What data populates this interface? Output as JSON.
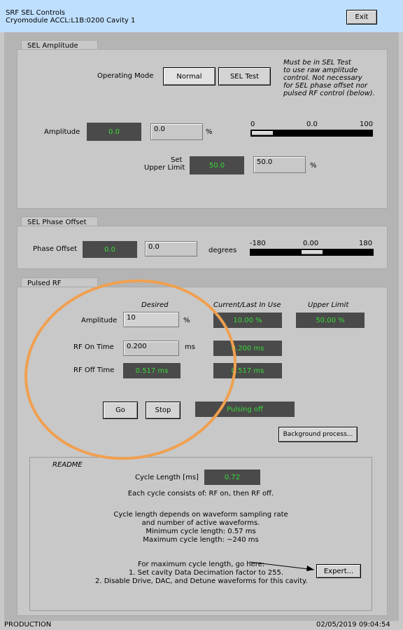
{
  "window": {
    "title_line1": "SRF SEL Controls",
    "title_line2": "Cryomodule ACCL:L1B:0200 Cavity 1",
    "exit_label": "Exit"
  },
  "sel_amplitude": {
    "tab": "SEL Amplitude",
    "operating_mode_label": "Operating Mode",
    "mode_normal": "Normal",
    "mode_sel_test": "SEL Test",
    "note_lines": [
      "Must be in SEL Test",
      "to use raw amplitude",
      "control. Not necessary",
      "for SEL phase offset nor",
      "pulsed RF control (below)."
    ],
    "amplitude_label": "Amplitude",
    "amplitude_readback": "0.0",
    "amplitude_input": "0.0",
    "amplitude_unit": "%",
    "slider_min": "0",
    "slider_value": "0.0",
    "slider_max": "100",
    "slider_fraction": 0.0,
    "set_label": "Set",
    "upper_limit_label": "Upper Limit",
    "upper_limit_readback": "50.0",
    "upper_limit_input": "50.0",
    "upper_limit_unit": "%"
  },
  "sel_phase": {
    "tab": "SEL Phase Offset",
    "label": "Phase Offset",
    "readback": "0.0",
    "input": "0.0",
    "unit": "degrees",
    "slider_min": "-180",
    "slider_value": "0.00",
    "slider_max": "180"
  },
  "pulsed_rf": {
    "tab": "Pulsed RF",
    "col_desired": "Desired",
    "col_current": "Current/Last In Use",
    "col_upper": "Upper Limit",
    "amplitude_label": "Amplitude",
    "amplitude_input": "10",
    "amplitude_unit": "%",
    "amplitude_current": "10.00 %",
    "amplitude_upper": "50.00 %",
    "on_time_label": "RF On Time",
    "on_time_input": "0.200",
    "on_time_unit": "ms",
    "on_time_current": "0.200 ms",
    "off_time_label": "RF Off Time",
    "off_time_desired": "0.517 ms",
    "off_time_current": "0.517 ms",
    "go_label": "Go",
    "stop_label": "Stop",
    "status": "Pulsing off",
    "background_label": "Background process..."
  },
  "readme": {
    "title": "README",
    "cycle_label": "Cycle Length [ms]",
    "cycle_value": "0.72",
    "line1": "Each cycle consists of: RF on, then RF off.",
    "line2": "Cycle length depends on waveform sampling rate",
    "line3": "and number of active waveforms.",
    "line4": "Minimum cycle length: 0.57 ms",
    "line5": "Maximum cycle length: ~240 ms",
    "line6": "For maximum cycle length, go here:",
    "line7": "1. Set cavity Data Decimation factor to 255.",
    "line8": "2. Disable Drive, DAC, and Detune waveforms for this cavity.",
    "expert_label": "Expert..."
  },
  "footer": {
    "left": "PRODUCTION",
    "right": "02/05/2019 09:04:54"
  },
  "colors": {
    "title_bg": "#bfdfff",
    "readback_bg": "#4a4a4a",
    "readback_text": "#38d838",
    "annotation_circle": "#f0a050"
  }
}
